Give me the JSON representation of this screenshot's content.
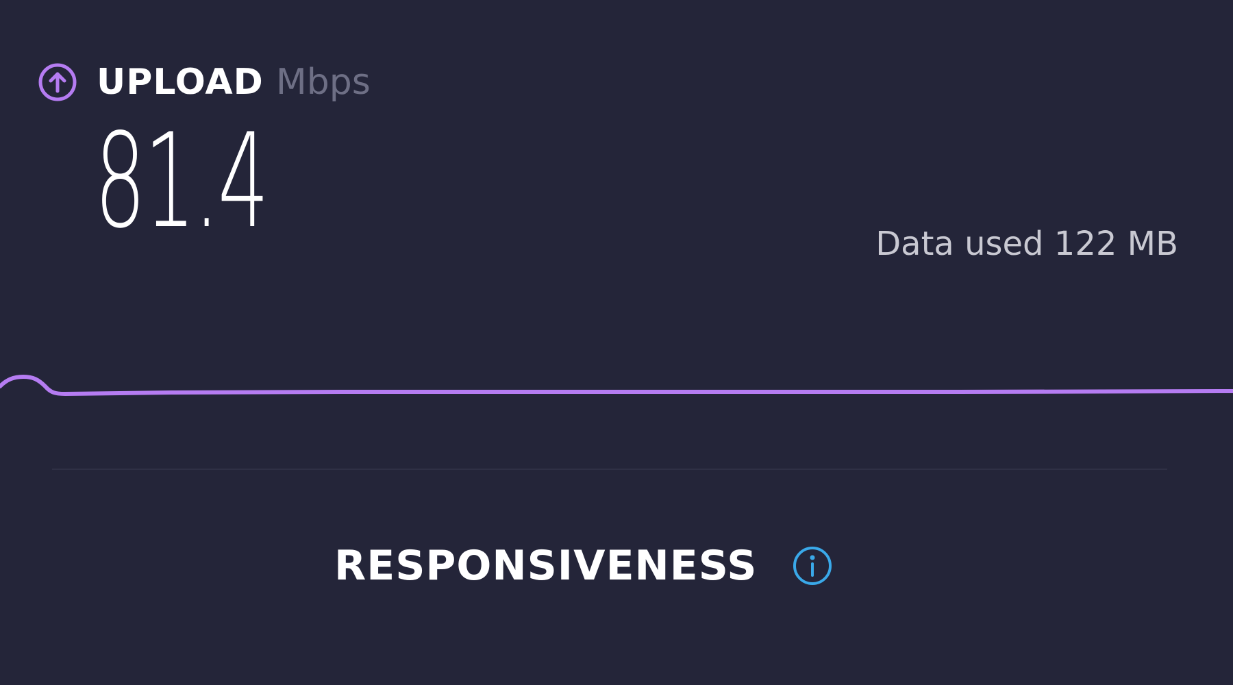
{
  "upload": {
    "label": "UPLOAD",
    "unit": "Mbps",
    "value": "81.4",
    "icon": "arrow-up-circle-icon",
    "accent_color": "#b57cf2"
  },
  "data_used": {
    "text": "Data used 122 MB"
  },
  "responsiveness": {
    "title": "RESPONSIVENESS",
    "icon": "info-icon",
    "icon_color": "#3aa9e9"
  },
  "theme": {
    "background": "#242539",
    "muted_text": "#6e6f85",
    "secondary_text": "#c9c9d2"
  }
}
